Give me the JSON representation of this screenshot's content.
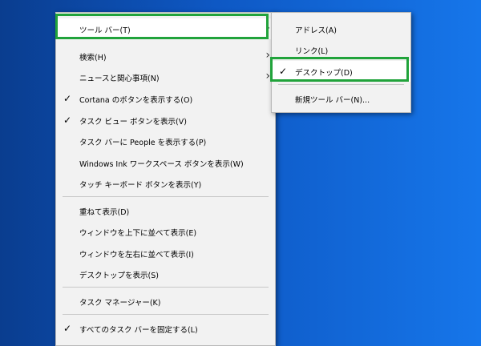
{
  "main_menu": {
    "toolbars": "ツール バー(T)",
    "search": "検索(H)",
    "news": "ニュースと関心事項(N)",
    "cortana": "Cortana のボタンを表示する(O)",
    "task_view": "タスク ビュー ボタンを表示(V)",
    "people": "タスク バーに People を表示する(P)",
    "ink": "Windows Ink ワークスペース ボタンを表示(W)",
    "touch_keyboard": "タッチ キーボード ボタンを表示(Y)",
    "cascade": "重ねて表示(D)",
    "stack": "ウィンドウを上下に並べて表示(E)",
    "side_by_side": "ウィンドウを左右に並べて表示(I)",
    "show_desktop": "デスクトップを表示(S)",
    "task_manager": "タスク マネージャー(K)",
    "lock_taskbar": "すべてのタスク バーを固定する(L)"
  },
  "sub_menu": {
    "address": "アドレス(A)",
    "links": "リンク(L)",
    "desktop": "デスクトップ(D)",
    "new_toolbar": "新規ツール バー(N)..."
  },
  "checked": [
    "cortana",
    "task_view",
    "lock_taskbar",
    "desktop"
  ],
  "icons": {
    "check": "✓",
    "submenu_arrow": "›"
  },
  "colors": {
    "highlight": "#21a33b",
    "menu_bg": "#f2f2f2"
  }
}
